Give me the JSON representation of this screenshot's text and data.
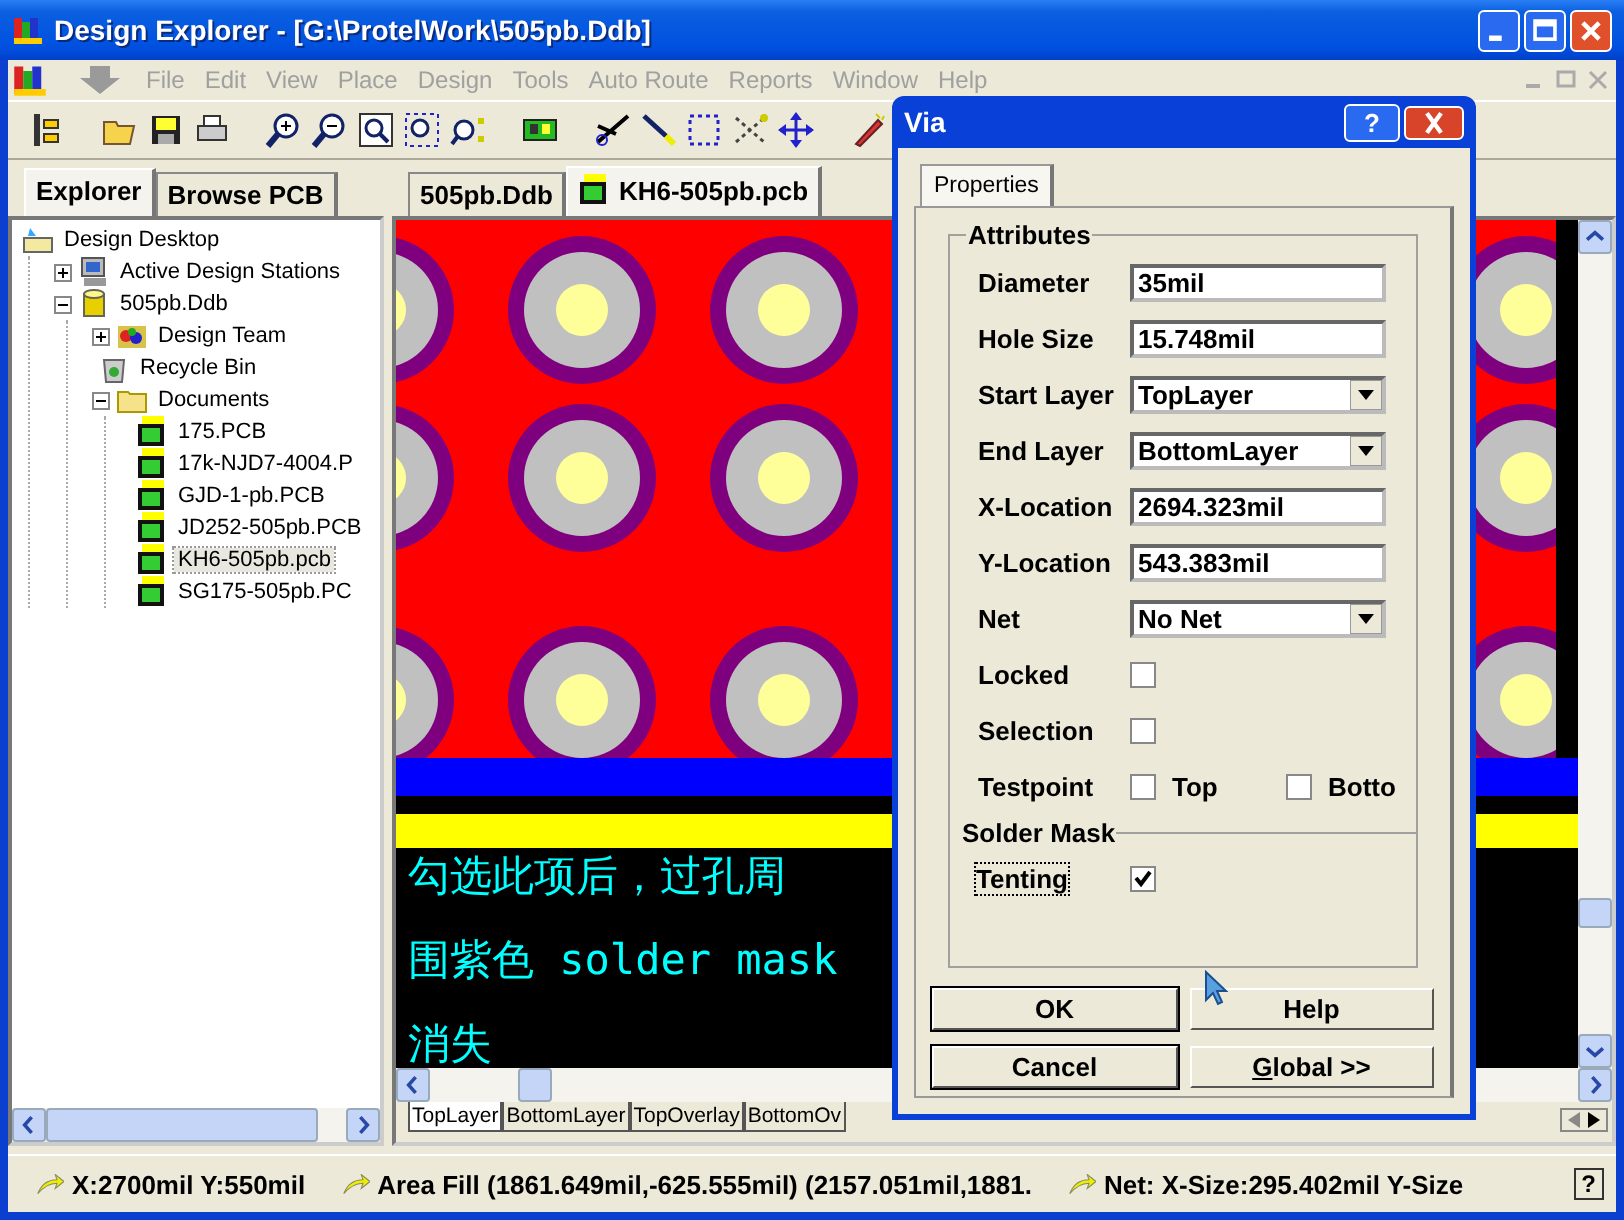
{
  "window": {
    "title": "Design Explorer - [G:\\ProtelWork\\505pb.Ddb]"
  },
  "menu": [
    {
      "label": "File",
      "disabled": true
    },
    {
      "label": "Edit",
      "disabled": true
    },
    {
      "label": "View",
      "disabled": true
    },
    {
      "label": "Place",
      "disabled": true
    },
    {
      "label": "Design",
      "disabled": true
    },
    {
      "label": "Tools",
      "disabled": true
    },
    {
      "label": "Auto Route",
      "disabled": true
    },
    {
      "label": "Reports",
      "disabled": true
    },
    {
      "label": "Window",
      "disabled": true
    },
    {
      "label": "Help",
      "disabled": true
    }
  ],
  "explorer": {
    "tabs": [
      {
        "label": "Explorer",
        "selected": true
      },
      {
        "label": "Browse PCB",
        "selected": false
      }
    ],
    "tree": [
      {
        "label": "Design Desktop",
        "kind": "desktop",
        "children": [
          {
            "label": "Active Design Stations",
            "kind": "stations",
            "expanded": false
          },
          {
            "label": "505pb.Ddb",
            "kind": "database",
            "expanded": true,
            "children": [
              {
                "label": "Design Team",
                "kind": "team",
                "expanded": false
              },
              {
                "label": "Recycle Bin",
                "kind": "recycle"
              },
              {
                "label": "Documents",
                "kind": "folder",
                "expanded": true,
                "children": [
                  {
                    "label": "175.PCB",
                    "kind": "pcb",
                    "selected": false
                  },
                  {
                    "label": "17k-NJD7-4004.P",
                    "kind": "pcb",
                    "selected": false
                  },
                  {
                    "label": "GJD-1-pb.PCB",
                    "kind": "pcb",
                    "selected": false
                  },
                  {
                    "label": "JD252-505pb.PCB",
                    "kind": "pcb",
                    "selected": false
                  },
                  {
                    "label": "KH6-505pb.pcb",
                    "kind": "pcb",
                    "selected": true
                  },
                  {
                    "label": "SG175-505pb.PC",
                    "kind": "pcb",
                    "selected": false
                  }
                ]
              }
            ]
          }
        ]
      }
    ]
  },
  "document_tabs": [
    {
      "label": "505pb.Ddb",
      "kind": "database",
      "selected": false
    },
    {
      "label": "KH6-505pb.pcb",
      "kind": "pcb",
      "selected": true
    }
  ],
  "canvas": {
    "annotation_lines": [
      "勾选此项后，过孔周",
      "围紫色 solder mask",
      "消失"
    ]
  },
  "layer_tabs": [
    {
      "label": "TopLayer",
      "selected": true
    },
    {
      "label": "BottomLayer",
      "selected": false
    },
    {
      "label": "TopOverlay",
      "selected": false
    },
    {
      "label": "BottomOv",
      "selected": false
    }
  ],
  "via_dialog": {
    "title": "Via",
    "help_glyph": "?",
    "tabs": [
      {
        "label": "Properties",
        "selected": true
      }
    ],
    "group_title": "Attributes",
    "fields": [
      {
        "kind": "text",
        "label": "Diameter",
        "value": "35mil"
      },
      {
        "kind": "text",
        "label": "Hole Size",
        "value": "15.748mil"
      },
      {
        "kind": "dropdown",
        "label": "Start Layer",
        "value": "TopLayer"
      },
      {
        "kind": "dropdown",
        "label": "End Layer",
        "value": "BottomLayer"
      },
      {
        "kind": "text",
        "label": "X-Location",
        "value": "2694.323mil"
      },
      {
        "kind": "text",
        "label": "Y-Location",
        "value": "543.383mil"
      },
      {
        "kind": "dropdown",
        "label": "Net",
        "value": "No Net"
      },
      {
        "kind": "checkbox",
        "label": "Locked",
        "checked": false
      },
      {
        "kind": "checkbox",
        "label": "Selection",
        "checked": false
      },
      {
        "kind": "testpoint",
        "label": "Testpoint",
        "options": [
          {
            "label": "Top",
            "checked": false
          },
          {
            "label": "Botto",
            "checked": false
          }
        ]
      }
    ],
    "solder_mask": {
      "title": "Solder Mask",
      "label": "Tenting",
      "checked": true,
      "focused": true
    },
    "buttons": [
      "OK",
      "Help",
      "Cancel",
      "Global >>"
    ]
  },
  "status_bar": {
    "items": [
      "X:2700mil Y:550mil",
      "Area Fill (1861.649mil,-625.555mil) (2157.051mil,1881.",
      "Net: X-Size:295.402mil Y-Size"
    ],
    "help_glyph": "?"
  }
}
